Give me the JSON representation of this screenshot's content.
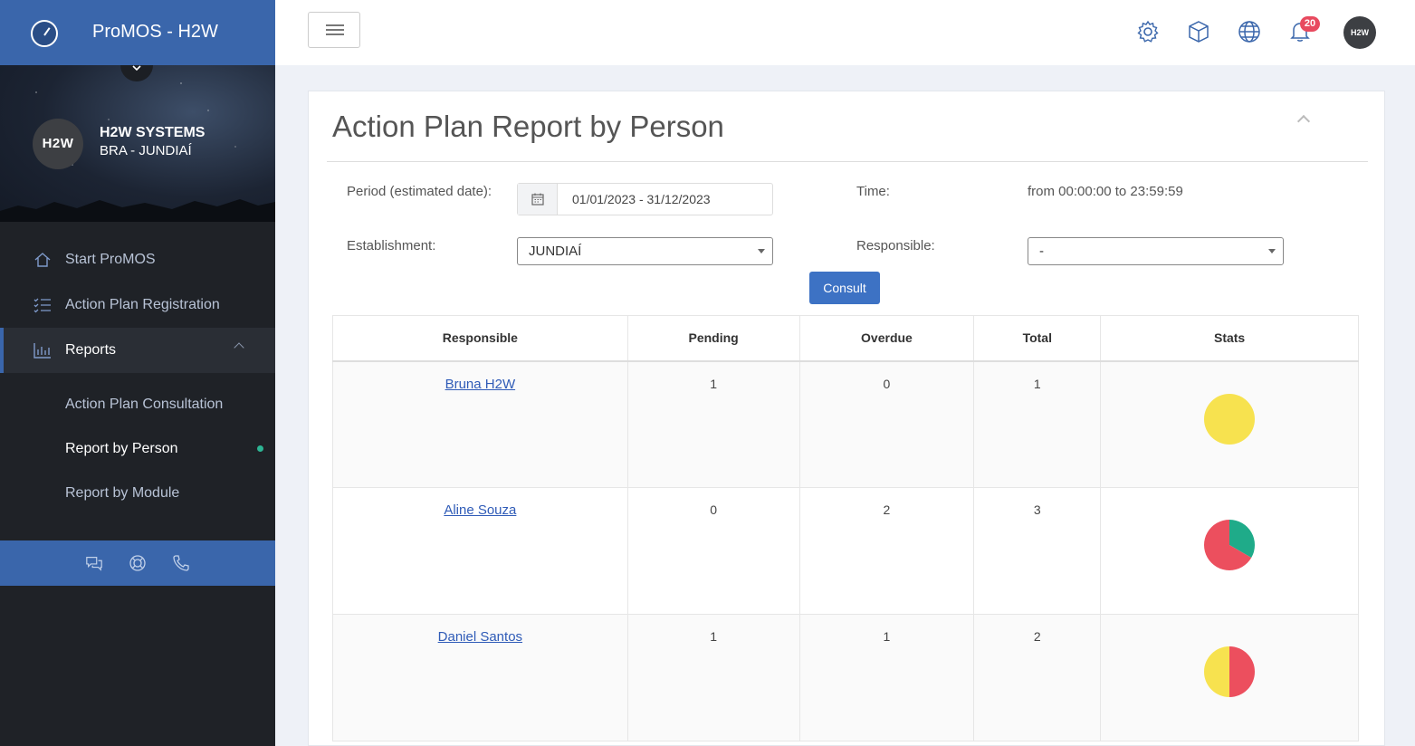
{
  "app": {
    "title": "ProMOS - H2W",
    "company": "H2W SYSTEMS",
    "location": "BRA - JUNDIAÍ",
    "avatar_text": "H2W"
  },
  "sidebar": {
    "items": [
      {
        "label": "Start ProMOS",
        "icon": "home-icon"
      },
      {
        "label": "Action Plan Registration",
        "icon": "list-check-icon"
      },
      {
        "label": "Reports",
        "icon": "bar-chart-icon"
      }
    ],
    "reports_sub": [
      {
        "label": "Action Plan Consultation"
      },
      {
        "label": "Report by Person"
      },
      {
        "label": "Report by Module"
      }
    ],
    "bottom_icons": [
      "chat-icon",
      "lifebuoy-icon",
      "phone-icon"
    ]
  },
  "topbar": {
    "icons": [
      "gear-icon",
      "cube-icon",
      "globe-icon",
      "bell-icon"
    ],
    "notification_count": "20",
    "avatar_text": "H2W"
  },
  "page": {
    "title": "Action Plan Report by Person"
  },
  "filters": {
    "period_label": "Period (estimated date):",
    "period_value": "01/01/2023 - 31/12/2023",
    "time_label": "Time:",
    "time_value": "from 00:00:00 to 23:59:59",
    "establishment_label": "Establishment:",
    "establishment_value": "JUNDIAÍ",
    "responsible_label": "Responsible:",
    "responsible_value": "-",
    "consult_label": "Consult"
  },
  "table": {
    "headers": [
      "Responsible",
      "Pending",
      "Overdue",
      "Total",
      "Stats"
    ],
    "rows": [
      {
        "name": "Bruna H2W",
        "pending": "1",
        "overdue": "0",
        "total": "1",
        "stats": {
          "pending": 1,
          "overdue": 0,
          "other": 0
        }
      },
      {
        "name": "Aline Souza",
        "pending": "0",
        "overdue": "2",
        "total": "3",
        "stats": {
          "pending": 0,
          "overdue": 2,
          "other": 1
        }
      },
      {
        "name": "Daniel Santos",
        "pending": "1",
        "overdue": "1",
        "total": "2",
        "stats": {
          "pending": 1,
          "overdue": 1,
          "other": 0
        }
      }
    ]
  },
  "colors": {
    "brand": "#3a66ab",
    "pending": "#f7e24f",
    "overdue": "#ec4f5e",
    "other": "#1fab89",
    "link": "#2f5bb7"
  }
}
